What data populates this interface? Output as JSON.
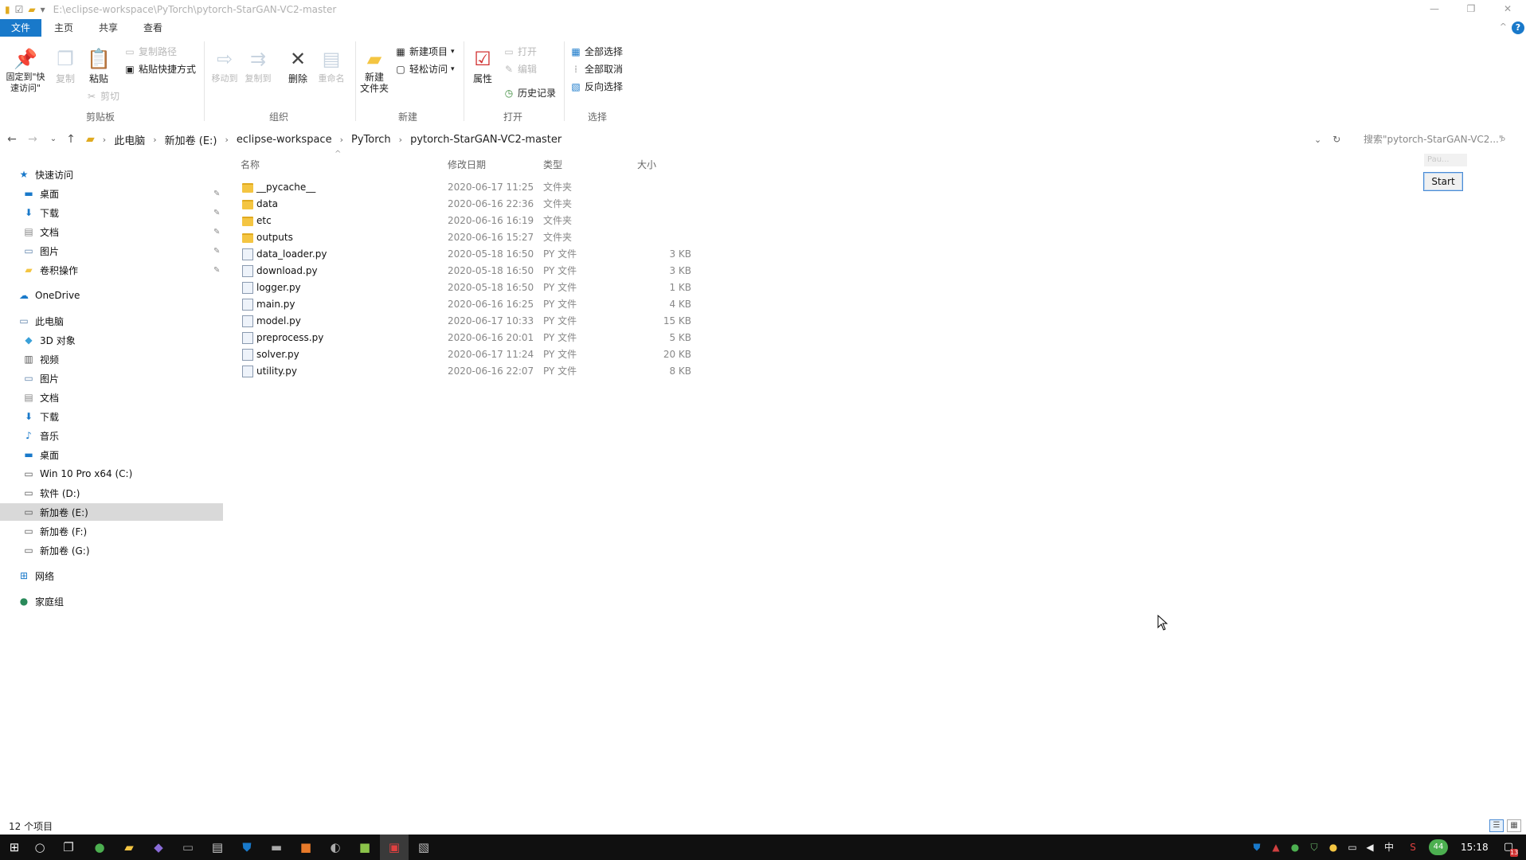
{
  "window": {
    "title": "E:\\eclipse-workspace\\PyTorch\\pytorch-StarGAN-VC2-master",
    "controls": {
      "minimize": "—",
      "maximize": "❐",
      "close": "✕"
    }
  },
  "ribbon_tabs": {
    "file": "文件",
    "home": "主页",
    "share": "共享",
    "view": "查看"
  },
  "ribbon": {
    "clipboard": {
      "pin": "固定到\"快速访问\"",
      "copy": "复制",
      "paste": "粘贴",
      "copy_path": "复制路径",
      "paste_shortcut": "粘贴快捷方式",
      "cut": "剪切",
      "group": "剪贴板"
    },
    "organize": {
      "move_to": "移动到",
      "copy_to": "复制到",
      "delete": "删除",
      "rename": "重命名",
      "group": "组织"
    },
    "new": {
      "new_folder": "新建\n文件夹",
      "new_item": "新建项目",
      "easy_access": "轻松访问",
      "group": "新建"
    },
    "open": {
      "properties": "属性",
      "open": "打开",
      "edit": "编辑",
      "history": "历史记录",
      "group": "打开"
    },
    "select": {
      "select_all": "全部选择",
      "select_none": "全部取消",
      "invert": "反向选择",
      "group": "选择"
    }
  },
  "breadcrumb": [
    "此电脑",
    "新加卷 (E:)",
    "eclipse-workspace",
    "PyTorch",
    "pytorch-StarGAN-VC2-master"
  ],
  "search": {
    "placeholder": "搜索\"pytorch-StarGAN-VC2...\""
  },
  "navpane": {
    "quick_access": "快速访问",
    "quick_items": [
      "桌面",
      "下载",
      "文档",
      "图片",
      "卷积操作"
    ],
    "onedrive": "OneDrive",
    "this_pc": "此电脑",
    "pc_items": [
      "3D 对象",
      "视频",
      "图片",
      "文档",
      "下载",
      "音乐",
      "桌面"
    ],
    "drives": [
      "Win 10 Pro x64 (C:)",
      "软件 (D:)",
      "新加卷 (E:)",
      "新加卷 (F:)",
      "新加卷 (G:)"
    ],
    "network": "网络",
    "homegroup": "家庭组"
  },
  "columns": {
    "name": "名称",
    "date": "修改日期",
    "type": "类型",
    "size": "大小"
  },
  "files": [
    {
      "name": "__pycache__",
      "date": "2020-06-17 11:25",
      "type": "文件夹",
      "size": "",
      "kind": "folder"
    },
    {
      "name": "data",
      "date": "2020-06-16 22:36",
      "type": "文件夹",
      "size": "",
      "kind": "folder"
    },
    {
      "name": "etc",
      "date": "2020-06-16 16:19",
      "type": "文件夹",
      "size": "",
      "kind": "folder"
    },
    {
      "name": "outputs",
      "date": "2020-06-16 15:27",
      "type": "文件夹",
      "size": "",
      "kind": "folder"
    },
    {
      "name": "data_loader.py",
      "date": "2020-05-18 16:50",
      "type": "PY 文件",
      "size": "3 KB",
      "kind": "py"
    },
    {
      "name": "download.py",
      "date": "2020-05-18 16:50",
      "type": "PY 文件",
      "size": "3 KB",
      "kind": "py"
    },
    {
      "name": "logger.py",
      "date": "2020-05-18 16:50",
      "type": "PY 文件",
      "size": "1 KB",
      "kind": "py"
    },
    {
      "name": "main.py",
      "date": "2020-06-16 16:25",
      "type": "PY 文件",
      "size": "4 KB",
      "kind": "py"
    },
    {
      "name": "model.py",
      "date": "2020-06-17 10:33",
      "type": "PY 文件",
      "size": "15 KB",
      "kind": "py"
    },
    {
      "name": "preprocess.py",
      "date": "2020-06-16 20:01",
      "type": "PY 文件",
      "size": "5 KB",
      "kind": "py"
    },
    {
      "name": "solver.py",
      "date": "2020-06-17 11:24",
      "type": "PY 文件",
      "size": "20 KB",
      "kind": "py"
    },
    {
      "name": "utility.py",
      "date": "2020-06-16 22:07",
      "type": "PY 文件",
      "size": "8 KB",
      "kind": "py"
    }
  ],
  "widget": {
    "hint": "Pau...",
    "start": "Start"
  },
  "status": {
    "count": "12 个项目"
  },
  "taskbar": {
    "time": "15:18",
    "ime": "中",
    "badge": "13",
    "net": "44"
  },
  "colors": {
    "accent": "#1979ca",
    "selected": "#d9d9d9",
    "taskbar": "#101010"
  }
}
